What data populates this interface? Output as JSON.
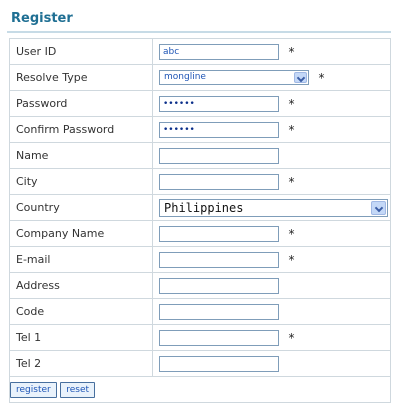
{
  "title": "Register",
  "fields": [
    {
      "label": "User ID",
      "type": "text",
      "value": "abc",
      "required": true
    },
    {
      "label": "Resolve Type",
      "type": "select",
      "value": "mongline",
      "required": true
    },
    {
      "label": "Password",
      "type": "password",
      "value": "••••••",
      "required": true
    },
    {
      "label": "Confirm Password",
      "type": "password",
      "value": "••••••",
      "required": true
    },
    {
      "label": "Name",
      "type": "text",
      "value": "",
      "required": false
    },
    {
      "label": "City",
      "type": "text",
      "value": "",
      "required": true
    },
    {
      "label": "Country",
      "type": "select",
      "value": "Philippines",
      "required": false
    },
    {
      "label": "Company Name",
      "type": "text",
      "value": "",
      "required": true
    },
    {
      "label": "E-mail",
      "type": "text",
      "value": "",
      "required": true
    },
    {
      "label": "Address",
      "type": "text",
      "value": "",
      "required": false
    },
    {
      "label": "Code",
      "type": "text",
      "value": "",
      "required": false
    },
    {
      "label": "Tel 1",
      "type": "text",
      "value": "",
      "required": true
    },
    {
      "label": "Tel 2",
      "type": "text",
      "value": "",
      "required": false
    }
  ],
  "required_marker": "*",
  "buttons": {
    "register": "register",
    "reset": "reset"
  },
  "colors": {
    "title": "#1f6f93",
    "border": "#cfd8de",
    "input_border": "#7f9db9"
  }
}
